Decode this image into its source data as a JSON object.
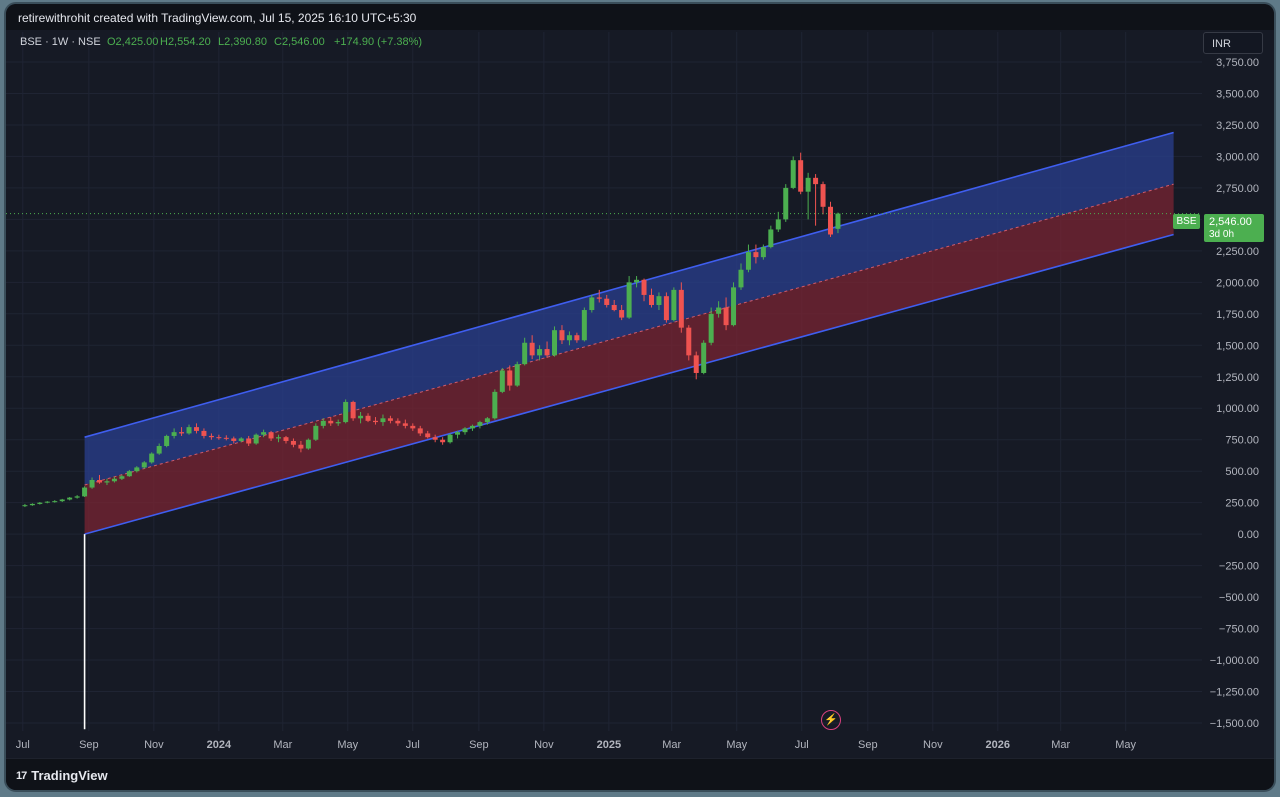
{
  "header": {
    "attribution": "retirewithrohit created with TradingView.com, Jul 15, 2025 16:10 UTC+5:30"
  },
  "legend": {
    "symbol": "BSE · 1W · NSE",
    "open": "O2,425.00",
    "high": "H2,554.20",
    "low": "L2,390.80",
    "close": "C2,546.00",
    "change": "+174.90 (+7.38%)"
  },
  "currency": "INR",
  "price_badge": {
    "symbol": "BSE",
    "price": "2,546.00",
    "countdown": "3d 0h"
  },
  "footer": {
    "brand": "TradingView",
    "logo_icon": "tradingview-logo-icon"
  },
  "colors": {
    "up": "#4caf50",
    "down": "#ef5350",
    "channel_upper_fill": "#2a3f8f",
    "channel_lower_fill": "#7a2433",
    "channel_line": "#3f5ef0",
    "background": "#161a25"
  },
  "chart_data": {
    "type": "candlestick",
    "y_range": [
      -1500,
      3750
    ],
    "y_ticks": [
      3750,
      3500,
      3250,
      3000,
      2750,
      2500,
      2250,
      2000,
      1750,
      1500,
      1250,
      1000,
      750,
      500,
      250,
      0,
      -250,
      -500,
      -750,
      -1000,
      -1250,
      -1500
    ],
    "y_tick_labels": [
      "3,750.00",
      "3,500.00",
      "3,250.00",
      "3,000.00",
      "2,750.00",
      "2,500.00",
      "2,250.00",
      "2,000.00",
      "1,750.00",
      "1,500.00",
      "1,250.00",
      "1,000.00",
      "750.00",
      "500.00",
      "250.00",
      "0.00",
      "−250.00",
      "−500.00",
      "−750.00",
      "−1,000.00",
      "−1,250.00",
      "−1,500.00"
    ],
    "x_labels": [
      {
        "label": "Jul",
        "date": "2023-07-01"
      },
      {
        "label": "Sep",
        "date": "2023-09-01"
      },
      {
        "label": "Nov",
        "date": "2023-11-01"
      },
      {
        "label": "2024",
        "date": "2024-01-01"
      },
      {
        "label": "Mar",
        "date": "2024-03-01"
      },
      {
        "label": "May",
        "date": "2024-05-01"
      },
      {
        "label": "Jul",
        "date": "2024-07-01"
      },
      {
        "label": "Sep",
        "date": "2024-09-01"
      },
      {
        "label": "Nov",
        "date": "2024-11-01"
      },
      {
        "label": "2025",
        "date": "2025-01-01"
      },
      {
        "label": "Mar",
        "date": "2025-03-01"
      },
      {
        "label": "May",
        "date": "2025-05-01"
      },
      {
        "label": "Jul",
        "date": "2025-07-01"
      },
      {
        "label": "Sep",
        "date": "2025-09-01"
      },
      {
        "label": "Nov",
        "date": "2025-11-01"
      },
      {
        "label": "2026",
        "date": "2026-01-01"
      },
      {
        "label": "Mar",
        "date": "2026-03-01"
      },
      {
        "label": "May",
        "date": "2026-05-01"
      }
    ],
    "last_price": 2546,
    "channel": {
      "start_date": "2023-08-28",
      "end_date": "2026-06-15",
      "upper": [
        770,
        3190
      ],
      "mid": [
        390,
        2780
      ],
      "lower": [
        0,
        2380
      ]
    },
    "anchor_line": {
      "date": "2023-08-28",
      "from": 0,
      "to": -1550
    },
    "candles": [
      {
        "d": "2023-07-03",
        "o": 225,
        "h": 240,
        "l": 215,
        "c": 230
      },
      {
        "d": "2023-07-10",
        "o": 230,
        "h": 245,
        "l": 225,
        "c": 240
      },
      {
        "d": "2023-07-17",
        "o": 240,
        "h": 255,
        "l": 235,
        "c": 250
      },
      {
        "d": "2023-07-24",
        "o": 250,
        "h": 262,
        "l": 245,
        "c": 258
      },
      {
        "d": "2023-07-31",
        "o": 258,
        "h": 270,
        "l": 250,
        "c": 262
      },
      {
        "d": "2023-08-07",
        "o": 262,
        "h": 280,
        "l": 255,
        "c": 275
      },
      {
        "d": "2023-08-14",
        "o": 275,
        "h": 295,
        "l": 268,
        "c": 290
      },
      {
        "d": "2023-08-21",
        "o": 290,
        "h": 310,
        "l": 282,
        "c": 300
      },
      {
        "d": "2023-08-28",
        "o": 300,
        "h": 380,
        "l": 295,
        "c": 370
      },
      {
        "d": "2023-09-04",
        "o": 370,
        "h": 450,
        "l": 360,
        "c": 430
      },
      {
        "d": "2023-09-11",
        "o": 430,
        "h": 470,
        "l": 400,
        "c": 410
      },
      {
        "d": "2023-09-18",
        "o": 410,
        "h": 440,
        "l": 390,
        "c": 420
      },
      {
        "d": "2023-09-25",
        "o": 420,
        "h": 455,
        "l": 410,
        "c": 440
      },
      {
        "d": "2023-10-02",
        "o": 440,
        "h": 470,
        "l": 430,
        "c": 460
      },
      {
        "d": "2023-10-09",
        "o": 460,
        "h": 510,
        "l": 455,
        "c": 500
      },
      {
        "d": "2023-10-16",
        "o": 500,
        "h": 540,
        "l": 490,
        "c": 530
      },
      {
        "d": "2023-10-23",
        "o": 530,
        "h": 580,
        "l": 520,
        "c": 570
      },
      {
        "d": "2023-10-30",
        "o": 570,
        "h": 650,
        "l": 560,
        "c": 640
      },
      {
        "d": "2023-11-06",
        "o": 640,
        "h": 720,
        "l": 630,
        "c": 700
      },
      {
        "d": "2023-11-13",
        "o": 700,
        "h": 790,
        "l": 690,
        "c": 780
      },
      {
        "d": "2023-11-20",
        "o": 780,
        "h": 840,
        "l": 760,
        "c": 810
      },
      {
        "d": "2023-11-27",
        "o": 810,
        "h": 850,
        "l": 780,
        "c": 800
      },
      {
        "d": "2023-12-04",
        "o": 800,
        "h": 870,
        "l": 790,
        "c": 850
      },
      {
        "d": "2023-12-11",
        "o": 850,
        "h": 880,
        "l": 800,
        "c": 820
      },
      {
        "d": "2023-12-18",
        "o": 820,
        "h": 840,
        "l": 760,
        "c": 780
      },
      {
        "d": "2023-12-25",
        "o": 780,
        "h": 800,
        "l": 750,
        "c": 770
      },
      {
        "d": "2024-01-01",
        "o": 770,
        "h": 790,
        "l": 750,
        "c": 765
      },
      {
        "d": "2024-01-08",
        "o": 765,
        "h": 785,
        "l": 745,
        "c": 760
      },
      {
        "d": "2024-01-15",
        "o": 760,
        "h": 775,
        "l": 720,
        "c": 740
      },
      {
        "d": "2024-01-22",
        "o": 740,
        "h": 770,
        "l": 730,
        "c": 760
      },
      {
        "d": "2024-01-29",
        "o": 760,
        "h": 780,
        "l": 700,
        "c": 720
      },
      {
        "d": "2024-02-05",
        "o": 720,
        "h": 800,
        "l": 710,
        "c": 790
      },
      {
        "d": "2024-02-12",
        "o": 790,
        "h": 830,
        "l": 770,
        "c": 810
      },
      {
        "d": "2024-02-19",
        "o": 810,
        "h": 820,
        "l": 740,
        "c": 760
      },
      {
        "d": "2024-02-26",
        "o": 760,
        "h": 790,
        "l": 730,
        "c": 770
      },
      {
        "d": "2024-03-04",
        "o": 770,
        "h": 780,
        "l": 720,
        "c": 740
      },
      {
        "d": "2024-03-11",
        "o": 740,
        "h": 760,
        "l": 690,
        "c": 710
      },
      {
        "d": "2024-03-18",
        "o": 710,
        "h": 740,
        "l": 650,
        "c": 680
      },
      {
        "d": "2024-03-25",
        "o": 680,
        "h": 760,
        "l": 670,
        "c": 750
      },
      {
        "d": "2024-04-01",
        "o": 750,
        "h": 880,
        "l": 740,
        "c": 860
      },
      {
        "d": "2024-04-08",
        "o": 860,
        "h": 920,
        "l": 840,
        "c": 900
      },
      {
        "d": "2024-04-15",
        "o": 900,
        "h": 930,
        "l": 860,
        "c": 880
      },
      {
        "d": "2024-04-22",
        "o": 880,
        "h": 910,
        "l": 860,
        "c": 890
      },
      {
        "d": "2024-04-29",
        "o": 890,
        "h": 1070,
        "l": 880,
        "c": 1050
      },
      {
        "d": "2024-05-06",
        "o": 1050,
        "h": 1060,
        "l": 900,
        "c": 920
      },
      {
        "d": "2024-05-13",
        "o": 920,
        "h": 970,
        "l": 880,
        "c": 940
      },
      {
        "d": "2024-05-20",
        "o": 940,
        "h": 960,
        "l": 890,
        "c": 900
      },
      {
        "d": "2024-05-27",
        "o": 900,
        "h": 930,
        "l": 870,
        "c": 890
      },
      {
        "d": "2024-06-03",
        "o": 890,
        "h": 950,
        "l": 860,
        "c": 920
      },
      {
        "d": "2024-06-10",
        "o": 920,
        "h": 940,
        "l": 880,
        "c": 900
      },
      {
        "d": "2024-06-17",
        "o": 900,
        "h": 920,
        "l": 860,
        "c": 880
      },
      {
        "d": "2024-06-24",
        "o": 880,
        "h": 910,
        "l": 840,
        "c": 860
      },
      {
        "d": "2024-07-01",
        "o": 860,
        "h": 880,
        "l": 820,
        "c": 840
      },
      {
        "d": "2024-07-08",
        "o": 840,
        "h": 860,
        "l": 780,
        "c": 800
      },
      {
        "d": "2024-07-15",
        "o": 800,
        "h": 820,
        "l": 760,
        "c": 770
      },
      {
        "d": "2024-07-22",
        "o": 770,
        "h": 790,
        "l": 730,
        "c": 750
      },
      {
        "d": "2024-07-29",
        "o": 750,
        "h": 770,
        "l": 710,
        "c": 730
      },
      {
        "d": "2024-08-05",
        "o": 730,
        "h": 800,
        "l": 720,
        "c": 790
      },
      {
        "d": "2024-08-12",
        "o": 790,
        "h": 820,
        "l": 760,
        "c": 810
      },
      {
        "d": "2024-08-19",
        "o": 810,
        "h": 850,
        "l": 790,
        "c": 840
      },
      {
        "d": "2024-08-26",
        "o": 840,
        "h": 870,
        "l": 820,
        "c": 860
      },
      {
        "d": "2024-09-02",
        "o": 860,
        "h": 900,
        "l": 840,
        "c": 890
      },
      {
        "d": "2024-09-09",
        "o": 890,
        "h": 930,
        "l": 870,
        "c": 920
      },
      {
        "d": "2024-09-16",
        "o": 920,
        "h": 1150,
        "l": 910,
        "c": 1130
      },
      {
        "d": "2024-09-23",
        "o": 1130,
        "h": 1320,
        "l": 1120,
        "c": 1300
      },
      {
        "d": "2024-09-30",
        "o": 1300,
        "h": 1340,
        "l": 1140,
        "c": 1180
      },
      {
        "d": "2024-10-07",
        "o": 1180,
        "h": 1370,
        "l": 1170,
        "c": 1350
      },
      {
        "d": "2024-10-14",
        "o": 1350,
        "h": 1560,
        "l": 1340,
        "c": 1520
      },
      {
        "d": "2024-10-21",
        "o": 1520,
        "h": 1580,
        "l": 1390,
        "c": 1420
      },
      {
        "d": "2024-10-28",
        "o": 1420,
        "h": 1500,
        "l": 1380,
        "c": 1470
      },
      {
        "d": "2024-11-04",
        "o": 1470,
        "h": 1530,
        "l": 1400,
        "c": 1420
      },
      {
        "d": "2024-11-11",
        "o": 1420,
        "h": 1650,
        "l": 1410,
        "c": 1620
      },
      {
        "d": "2024-11-18",
        "o": 1620,
        "h": 1660,
        "l": 1510,
        "c": 1540
      },
      {
        "d": "2024-11-25",
        "o": 1540,
        "h": 1610,
        "l": 1500,
        "c": 1580
      },
      {
        "d": "2024-12-02",
        "o": 1580,
        "h": 1600,
        "l": 1520,
        "c": 1540
      },
      {
        "d": "2024-12-09",
        "o": 1540,
        "h": 1800,
        "l": 1530,
        "c": 1780
      },
      {
        "d": "2024-12-16",
        "o": 1780,
        "h": 1900,
        "l": 1760,
        "c": 1880
      },
      {
        "d": "2024-12-23",
        "o": 1880,
        "h": 1940,
        "l": 1840,
        "c": 1870
      },
      {
        "d": "2024-12-30",
        "o": 1870,
        "h": 1900,
        "l": 1800,
        "c": 1820
      },
      {
        "d": "2025-01-06",
        "o": 1820,
        "h": 1860,
        "l": 1770,
        "c": 1780
      },
      {
        "d": "2025-01-13",
        "o": 1780,
        "h": 1820,
        "l": 1700,
        "c": 1720
      },
      {
        "d": "2025-01-20",
        "o": 1720,
        "h": 2050,
        "l": 1710,
        "c": 2000
      },
      {
        "d": "2025-01-27",
        "o": 2000,
        "h": 2050,
        "l": 1960,
        "c": 2020
      },
      {
        "d": "2025-02-03",
        "o": 2020,
        "h": 2030,
        "l": 1850,
        "c": 1900
      },
      {
        "d": "2025-02-10",
        "o": 1900,
        "h": 1950,
        "l": 1800,
        "c": 1820
      },
      {
        "d": "2025-02-17",
        "o": 1820,
        "h": 1920,
        "l": 1780,
        "c": 1890
      },
      {
        "d": "2025-02-24",
        "o": 1890,
        "h": 1920,
        "l": 1680,
        "c": 1700
      },
      {
        "d": "2025-03-03",
        "o": 1700,
        "h": 1960,
        "l": 1690,
        "c": 1940
      },
      {
        "d": "2025-03-10",
        "o": 1940,
        "h": 2000,
        "l": 1600,
        "c": 1640
      },
      {
        "d": "2025-03-17",
        "o": 1640,
        "h": 1660,
        "l": 1380,
        "c": 1420
      },
      {
        "d": "2025-03-24",
        "o": 1420,
        "h": 1450,
        "l": 1230,
        "c": 1280
      },
      {
        "d": "2025-03-31",
        "o": 1280,
        "h": 1540,
        "l": 1270,
        "c": 1520
      },
      {
        "d": "2025-04-07",
        "o": 1520,
        "h": 1800,
        "l": 1500,
        "c": 1750
      },
      {
        "d": "2025-04-14",
        "o": 1750,
        "h": 1850,
        "l": 1720,
        "c": 1800
      },
      {
        "d": "2025-04-21",
        "o": 1800,
        "h": 1880,
        "l": 1620,
        "c": 1660
      },
      {
        "d": "2025-04-28",
        "o": 1660,
        "h": 2000,
        "l": 1650,
        "c": 1960
      },
      {
        "d": "2025-05-05",
        "o": 1960,
        "h": 2150,
        "l": 1940,
        "c": 2100
      },
      {
        "d": "2025-05-12",
        "o": 2100,
        "h": 2300,
        "l": 2080,
        "c": 2240
      },
      {
        "d": "2025-05-19",
        "o": 2240,
        "h": 2300,
        "l": 2150,
        "c": 2200
      },
      {
        "d": "2025-05-26",
        "o": 2200,
        "h": 2300,
        "l": 2180,
        "c": 2280
      },
      {
        "d": "2025-06-02",
        "o": 2280,
        "h": 2450,
        "l": 2270,
        "c": 2420
      },
      {
        "d": "2025-06-09",
        "o": 2420,
        "h": 2560,
        "l": 2400,
        "c": 2500
      },
      {
        "d": "2025-06-16",
        "o": 2500,
        "h": 2780,
        "l": 2480,
        "c": 2750
      },
      {
        "d": "2025-06-23",
        "o": 2750,
        "h": 3000,
        "l": 2740,
        "c": 2970
      },
      {
        "d": "2025-06-30",
        "o": 2970,
        "h": 3030,
        "l": 2700,
        "c": 2720
      },
      {
        "d": "2025-07-07",
        "o": 2720,
        "h": 2870,
        "l": 2500,
        "c": 2830
      },
      {
        "d": "2025-07-14",
        "o": 2830,
        "h": 2860,
        "l": 2450,
        "c": 2780
      },
      {
        "d": "2025-07-21",
        "o": 2780,
        "h": 2800,
        "l": 2540,
        "c": 2600
      },
      {
        "d": "2025-07-28",
        "o": 2600,
        "h": 2640,
        "l": 2360,
        "c": 2380
      },
      {
        "d": "2025-08-04",
        "o": 2425,
        "h": 2554.2,
        "l": 2390.8,
        "c": 2546
      }
    ]
  }
}
